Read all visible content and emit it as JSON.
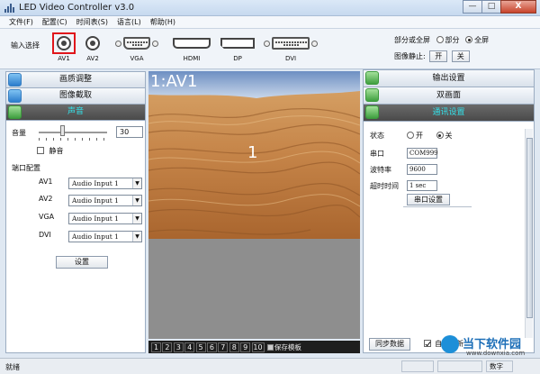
{
  "window": {
    "title": "LED Video Controller v3.0",
    "min": "—",
    "max": "□",
    "close": "X"
  },
  "menu": [
    "文件(F)",
    "配置(C)",
    "时间表(S)",
    "语言(L)",
    "帮助(H)"
  ],
  "toolbar": {
    "input_label": "输入选择",
    "ports": [
      {
        "name": "AV1",
        "icon": "bnc-connector-icon",
        "selected": true
      },
      {
        "name": "AV2",
        "icon": "bnc-connector-icon",
        "selected": false
      },
      {
        "name": "VGA",
        "icon": "vga-connector-icon",
        "selected": false
      },
      {
        "name": "HDMI",
        "icon": "hdmi-connector-icon",
        "selected": false
      },
      {
        "name": "DP",
        "icon": "displayport-connector-icon",
        "selected": false
      },
      {
        "name": "DVI",
        "icon": "dvi-connector-icon",
        "selected": false
      }
    ],
    "fullscreen_label": "部分或全屏",
    "partial": "部分",
    "full": "全屏",
    "freeze_label": "图像静止:",
    "freeze_on": "开",
    "freeze_off": "关"
  },
  "left": {
    "tabs": [
      "画质调整",
      "图像截取",
      "声音"
    ],
    "volume_label": "音量",
    "volume_value": "30",
    "volume_fraction": 0.35,
    "mute_label": "静音",
    "port_config_label": "端口配置",
    "ports": [
      {
        "name": "AV1",
        "value": "Audio Input 1"
      },
      {
        "name": "AV2",
        "value": "Audio Input 1"
      },
      {
        "name": "VGA",
        "value": "Audio Input 1"
      },
      {
        "name": "DVI",
        "value": "Audio Input 1"
      }
    ],
    "set_button": "设置"
  },
  "preview": {
    "label": "1:AV1",
    "window_number": "1",
    "pages": [
      "1",
      "2",
      "3",
      "4",
      "5",
      "6",
      "7",
      "8",
      "9",
      "10"
    ],
    "save_template": "保存模板"
  },
  "right": {
    "tabs": [
      "输出设置",
      "双画面",
      "通讯设置"
    ],
    "state_label": "状态",
    "state_on": "开",
    "state_off": "关",
    "port_label": "串口",
    "port_value": "COM999",
    "baud_label": "波特率",
    "baud_value": "9600",
    "timeout_label": "超时时间",
    "timeout_value": "1 sec",
    "serial_button": "串口设置",
    "sync_button": "同步数据",
    "auto_refresh": "自动刷新"
  },
  "status": {
    "left": "就绪",
    "numlock": "数字"
  },
  "watermark": {
    "title": "当下软件园",
    "url": "www.downxia.com"
  },
  "colors": {
    "active_tab_bg": "#555555",
    "active_tab_text": "#33e0e8",
    "selected_port_border": "#e0161b"
  }
}
